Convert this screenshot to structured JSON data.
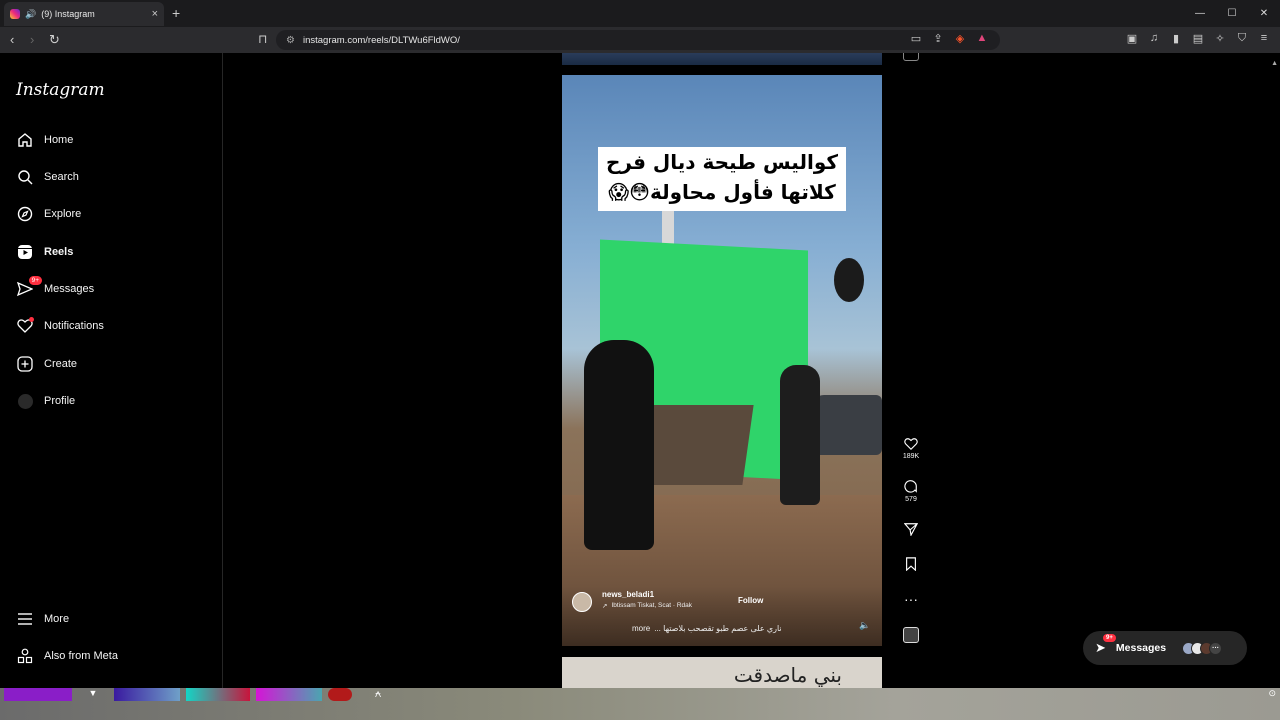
{
  "browser": {
    "tab_title": "(9) Instagram",
    "new_tab": "+",
    "url": "instagram.com/reels/DLTWu6FldWO/",
    "win_min": "—",
    "win_max": "☐",
    "win_close": "✕"
  },
  "sidebar": {
    "logo": "Instagram",
    "items": [
      {
        "label": "Home",
        "icon": "home-icon"
      },
      {
        "label": "Search",
        "icon": "search-icon"
      },
      {
        "label": "Explore",
        "icon": "compass-icon"
      },
      {
        "label": "Reels",
        "icon": "reels-icon"
      },
      {
        "label": "Messages",
        "icon": "messenger-icon",
        "badge": "9+"
      },
      {
        "label": "Notifications",
        "icon": "heart-icon"
      },
      {
        "label": "Create",
        "icon": "plus-square-icon"
      },
      {
        "label": "Profile",
        "icon": "avatar"
      }
    ],
    "more": "More",
    "also_from_meta": "Also from Meta"
  },
  "reel": {
    "caption_line1": "كواليس طيحة ديال فرح",
    "caption_line2": "كلاتها فأول محاولة😳😱",
    "author": "news_beladi1",
    "audio": "Ibtissam Tiskat, Scat · Rdak",
    "follow": "Follow",
    "description": "ناري على عصم طبو تقصحب بلاصتها ...",
    "more": "more",
    "next_caption": "بني ماصدقت"
  },
  "actions": {
    "likes": "189K",
    "comments": "579"
  },
  "messages_pill": {
    "label": "Messages",
    "badge": "9+",
    "more": "···"
  },
  "colors": {
    "accent_red": "#ff3040",
    "ig_bg": "#000000",
    "green_screen": "#2fd46a"
  }
}
